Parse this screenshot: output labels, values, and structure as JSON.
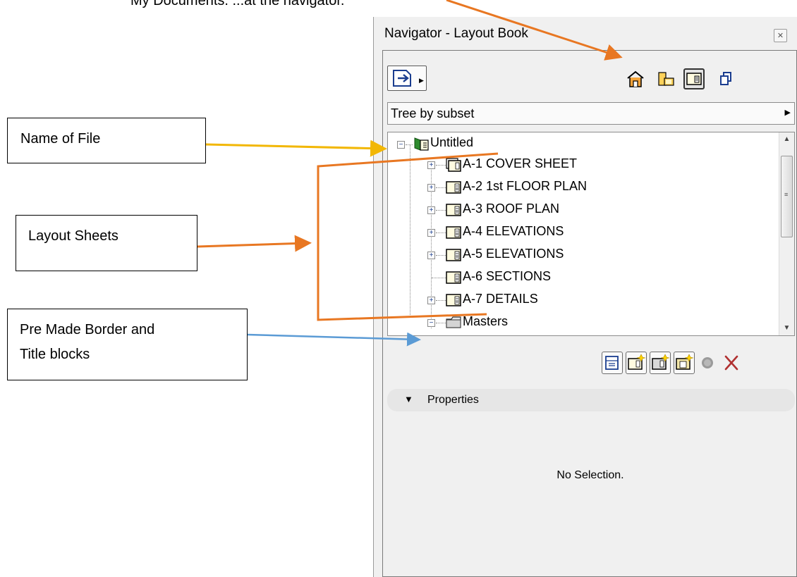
{
  "top_caption": "My Documents. ...at the navigator.",
  "callouts": {
    "name_of_file": "Name of File",
    "layout_sheets": "Layout Sheets",
    "pre_made_line1": "Pre Made Border and",
    "pre_made_line2": "Title blocks"
  },
  "colors": {
    "arrow_orange": "#e87722",
    "arrow_yellow": "#f2b705",
    "arrow_blue": "#5b9bd5"
  },
  "navigator": {
    "title": "Navigator - Layout Book",
    "close_icon": "close-icon",
    "toolbar": {
      "publish_icon": "publish-icon",
      "map_icon": "project-map-icon",
      "view_icon": "view-map-icon",
      "layout_icon": "layout-book-icon",
      "publisher_icon": "publisher-sets-icon"
    },
    "dropdown_value": "Tree by subset",
    "tree": {
      "root": "Untitled",
      "items": [
        {
          "label": "A-1 COVER SHEET",
          "expandable": true
        },
        {
          "label": "A-2 1st FLOOR PLAN",
          "expandable": true
        },
        {
          "label": "A-3 ROOF PLAN",
          "expandable": true
        },
        {
          "label": "A-4 ELEVATIONS",
          "expandable": true
        },
        {
          "label": "A-5 ELEVATIONS",
          "expandable": true
        },
        {
          "label": "A-6 SECTIONS",
          "expandable": false
        },
        {
          "label": "A-7 DETAILS",
          "expandable": true
        }
      ],
      "masters": "Masters"
    },
    "action_buttons": [
      "layout-settings-icon",
      "new-layout-icon",
      "new-master-icon",
      "new-subset-icon",
      "record-icon",
      "delete-icon"
    ],
    "properties_label": "Properties",
    "no_selection": "No Selection."
  }
}
